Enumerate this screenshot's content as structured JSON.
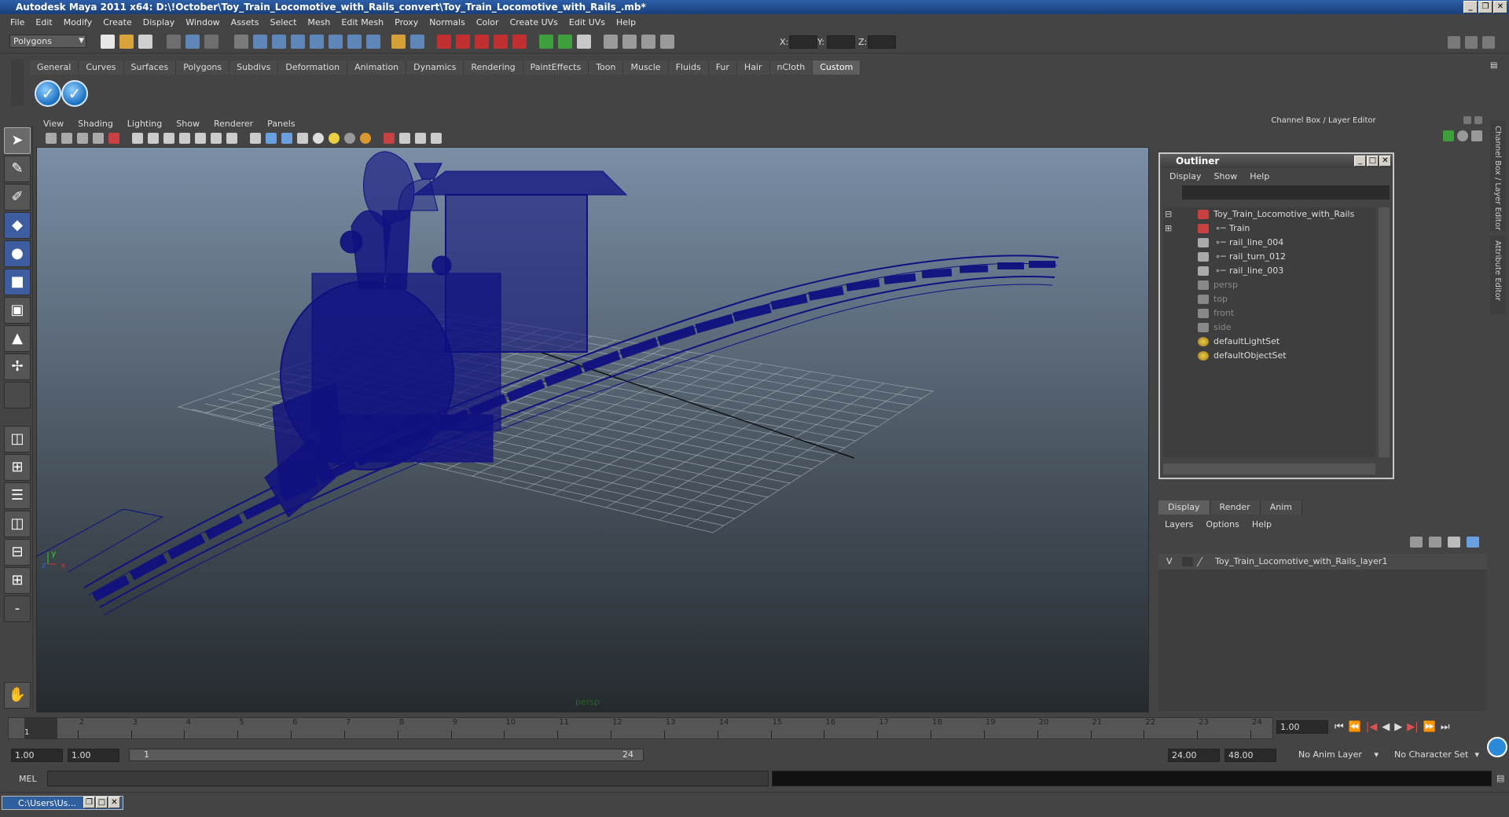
{
  "window": {
    "title": "Autodesk Maya 2011 x64: D:\\!October\\Toy_Train_Locomotive_with_Rails_convert\\Toy_Train_Locomotive_with_Rails_.mb*"
  },
  "menus": [
    "File",
    "Edit",
    "Modify",
    "Create",
    "Display",
    "Window",
    "Assets",
    "Select",
    "Mesh",
    "Edit Mesh",
    "Proxy",
    "Normals",
    "Color",
    "Create UVs",
    "Edit UVs",
    "Help"
  ],
  "status": {
    "mode": "Polygons",
    "x_label": "X:",
    "y_label": "Y:",
    "z_label": "Z:"
  },
  "shelf": {
    "tabs": [
      "General",
      "Curves",
      "Surfaces",
      "Polygons",
      "Subdivs",
      "Deformation",
      "Animation",
      "Dynamics",
      "Rendering",
      "PaintEffects",
      "Toon",
      "Muscle",
      "Fluids",
      "Fur",
      "Hair",
      "nCloth",
      "Custom"
    ],
    "active_tab": "Custom"
  },
  "panel": {
    "menus": [
      "View",
      "Shading",
      "Lighting",
      "Show",
      "Renderer",
      "Panels"
    ],
    "camera_label": "persp",
    "axis_y": "y",
    "axis_x": "x",
    "axis_z": "z"
  },
  "right_panel": {
    "header": "Channel Box / Layer Editor",
    "side_tab_1": "Channel Box / Layer Editor",
    "side_tab_2": "Attribute Editor"
  },
  "outliner": {
    "title": "Outliner",
    "menus": [
      "Display",
      "Show",
      "Help"
    ],
    "items": [
      {
        "label": "Toy_Train_Locomotive_with_Rails",
        "dim": false
      },
      {
        "label": "Train",
        "dim": false
      },
      {
        "label": "rail_line_004",
        "dim": false
      },
      {
        "label": "rail_turn_012",
        "dim": false
      },
      {
        "label": "rail_line_003",
        "dim": false
      },
      {
        "label": "persp",
        "dim": true
      },
      {
        "label": "top",
        "dim": true
      },
      {
        "label": "front",
        "dim": true
      },
      {
        "label": "side",
        "dim": true
      },
      {
        "label": "defaultLightSet",
        "dim": false
      },
      {
        "label": "defaultObjectSet",
        "dim": false
      }
    ]
  },
  "layer_editor": {
    "tabs": [
      "Display",
      "Render",
      "Anim"
    ],
    "menus": [
      "Layers",
      "Options",
      "Help"
    ],
    "layer": {
      "visible": "V",
      "name": "Toy_Train_Locomotive_with_Rails_layer1"
    }
  },
  "timeline": {
    "ticks": [
      "1",
      "2",
      "3",
      "4",
      "5",
      "6",
      "7",
      "8",
      "9",
      "10",
      "11",
      "12",
      "13",
      "14",
      "15",
      "16",
      "17",
      "18",
      "19",
      "20",
      "21",
      "22",
      "23",
      "24"
    ],
    "current_frame": "1.00",
    "start": "1.00",
    "start2": "1.00",
    "range_start": "1",
    "range_end": "24",
    "end": "24.00",
    "end2": "48.00",
    "anim_layer": "No Anim Layer",
    "character_set": "No Character Set"
  },
  "command": {
    "label": "MEL"
  },
  "taskbar": {
    "item": "C:\\Users\\Us..."
  },
  "colors": {
    "wireframe": "#101080",
    "title_blue": "#2d5fa8",
    "accent": "#1a6fc0"
  }
}
